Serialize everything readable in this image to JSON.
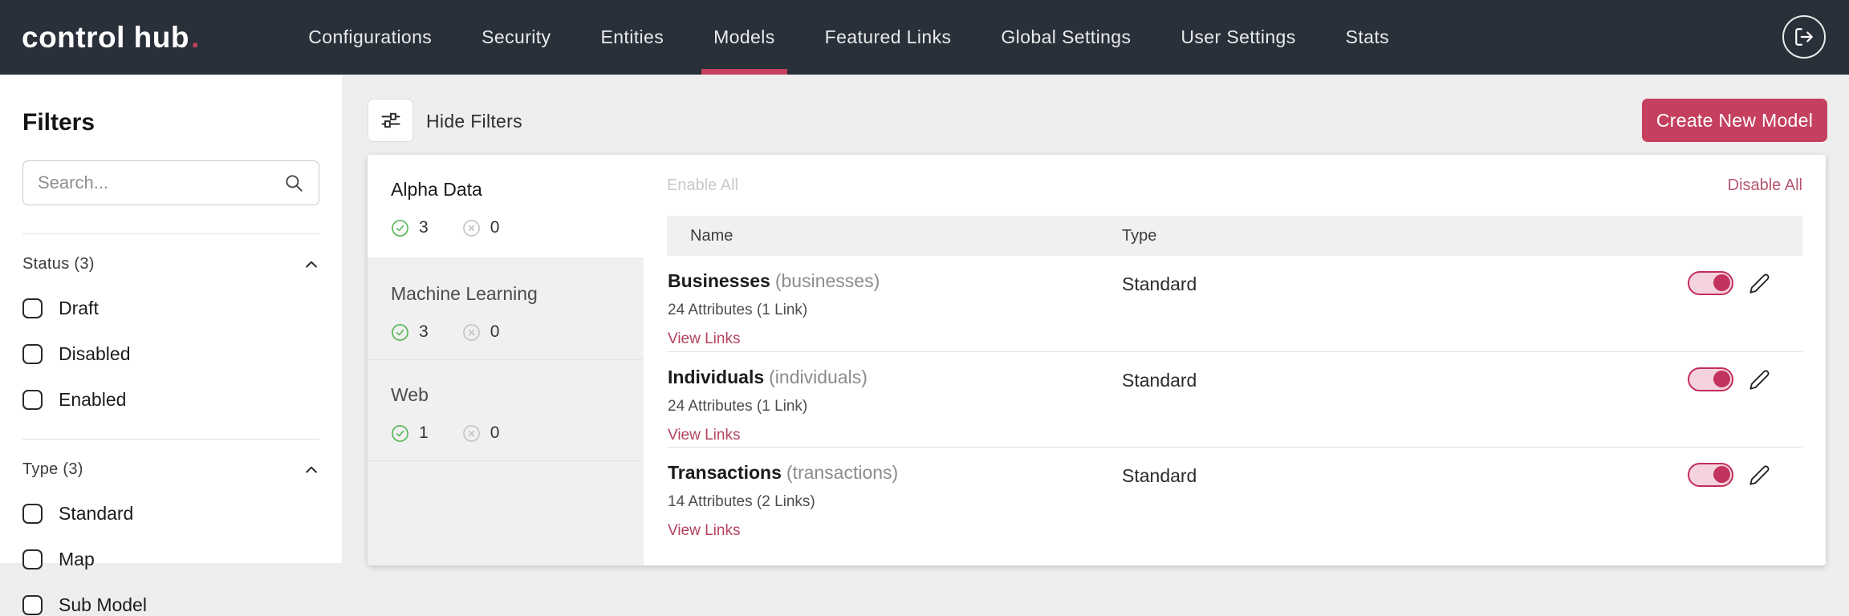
{
  "brand": {
    "name": "control hub",
    "dot": ".",
    "accent": "#c5405f"
  },
  "navbar": {
    "items": [
      {
        "label": "Configurations"
      },
      {
        "label": "Security"
      },
      {
        "label": "Entities"
      },
      {
        "label": "Models"
      },
      {
        "label": "Featured Links"
      },
      {
        "label": "Global Settings"
      },
      {
        "label": "User Settings"
      },
      {
        "label": "Stats"
      }
    ],
    "active_item": "Models"
  },
  "sidebar": {
    "title": "Filters",
    "search": {
      "placeholder": "Search..."
    },
    "sections": [
      {
        "label": "Status (3)",
        "options": [
          {
            "label": "Draft"
          },
          {
            "label": "Disabled"
          },
          {
            "label": "Enabled"
          }
        ]
      },
      {
        "label": "Type (3)",
        "options": [
          {
            "label": "Standard"
          },
          {
            "label": "Map"
          },
          {
            "label": "Sub Model"
          }
        ]
      }
    ]
  },
  "toolbar": {
    "hide_filters_label": "Hide Filters",
    "create_button_label": "Create New Model"
  },
  "categories": [
    {
      "name": "Alpha Data",
      "enabled_count": "3",
      "disabled_count": "0",
      "selected": true
    },
    {
      "name": "Machine Learning",
      "enabled_count": "3",
      "disabled_count": "0",
      "selected": false
    },
    {
      "name": "Web",
      "enabled_count": "1",
      "disabled_count": "0",
      "selected": false
    }
  ],
  "models_panel": {
    "enable_all_label": "Enable All",
    "disable_all_label": "Disable All",
    "columns": {
      "name": "Name",
      "type": "Type"
    },
    "rows": [
      {
        "name": "Businesses",
        "slug": "(businesses)",
        "attributes": "24 Attributes (1 Link)",
        "link_label": "View Links",
        "type": "Standard",
        "enabled": true
      },
      {
        "name": "Individuals",
        "slug": "(individuals)",
        "attributes": "24 Attributes (1 Link)",
        "link_label": "View Links",
        "type": "Standard",
        "enabled": true
      },
      {
        "name": "Transactions",
        "slug": "(transactions)",
        "attributes": "14 Attributes (2 Links)",
        "link_label": "View Links",
        "type": "Standard",
        "enabled": true
      }
    ]
  },
  "colors": {
    "navbar_bg": "#293039",
    "accent": "#c5405f",
    "toggle_fill": "#f5d3de",
    "enabled_icon": "#5cb85c",
    "disabled_icon": "#c6c6c6",
    "page_bg": "#efeeee"
  }
}
